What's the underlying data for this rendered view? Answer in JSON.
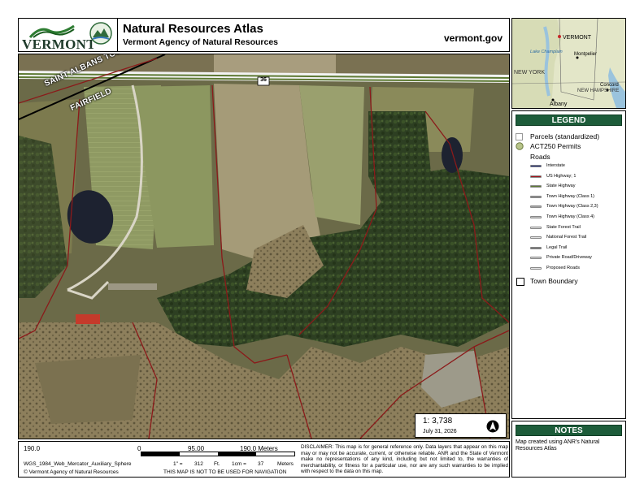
{
  "header": {
    "logo_text": "VERMONT",
    "title": "Natural Resources Atlas",
    "subtitle": "Vermont Agency of Natural Resources",
    "url": "vermont.gov"
  },
  "map": {
    "town_north": "SAINT ALBANS TOWN",
    "town_south": "FAIRFIELD",
    "route_shield": "36",
    "scale_ratio": "1:  3,738",
    "date": "July 31, 2026"
  },
  "locator": {
    "labels": [
      "VERMONT",
      "Lake Champlain",
      "Montpelier",
      "NEW YORK",
      "NEW HAMPSHIRE",
      "Concord",
      "Albany"
    ]
  },
  "legend": {
    "title": "LEGEND",
    "parcels": "Parcels (standardized)",
    "act250": "ACT250 Permits",
    "roads": "Roads",
    "road_items": [
      {
        "label": "Interstate",
        "color": "#1f2a78"
      },
      {
        "label": "US Highway; 1",
        "color": "#a3121a"
      },
      {
        "label": "State Highway",
        "color": "#5e7a34"
      },
      {
        "label": "Town Highway (Class 1)",
        "color": "#8c8c8c"
      },
      {
        "label": "Town Highway (Class 2,3)",
        "color": "#a5a5a5"
      },
      {
        "label": "Town Highway (Class 4)",
        "color": "#c8c8c8"
      },
      {
        "label": "State Forest Trail",
        "color": "#e1e1e1"
      },
      {
        "label": "National Forest Trail",
        "color": "#e1e1e1"
      },
      {
        "label": "Legal Trail",
        "color": "#6f6f6f"
      },
      {
        "label": "Private Road/Driveway",
        "color": "#d4d4d4"
      },
      {
        "label": "Proposed Roads",
        "color": "#e6e6e6"
      }
    ],
    "town_boundary": "Town Boundary"
  },
  "notes": {
    "title": "NOTES",
    "text": "Map created using ANR's Natural Resources Atlas"
  },
  "scalebar": {
    "left": "190.0",
    "zero": "0",
    "mid": "95.00",
    "right": "190.0 Meters",
    "projection": "WGS_1984_Web_Mercator_Auxiliary_Sphere",
    "copyright": "© Vermont Agency of Natural Resources",
    "inch": "1\" =",
    "inch_val": "312",
    "inch_unit": "Ft.",
    "cm": "1cm =",
    "cm_val": "37",
    "cm_unit": "Meters",
    "nav_warning": "THIS MAP IS NOT TO BE USED FOR NAVIGATION"
  },
  "disclaimer": "DISCLAIMER: This map is for general reference only. Data layers that appear on this map may or may not be accurate, current, or otherwise reliable. ANR and the State of Vermont make no representations of any kind, including but not limited to, the warranties of merchantability, or fitness for a particular use, nor are any such warranties to be implied with respect to the data on this map."
}
